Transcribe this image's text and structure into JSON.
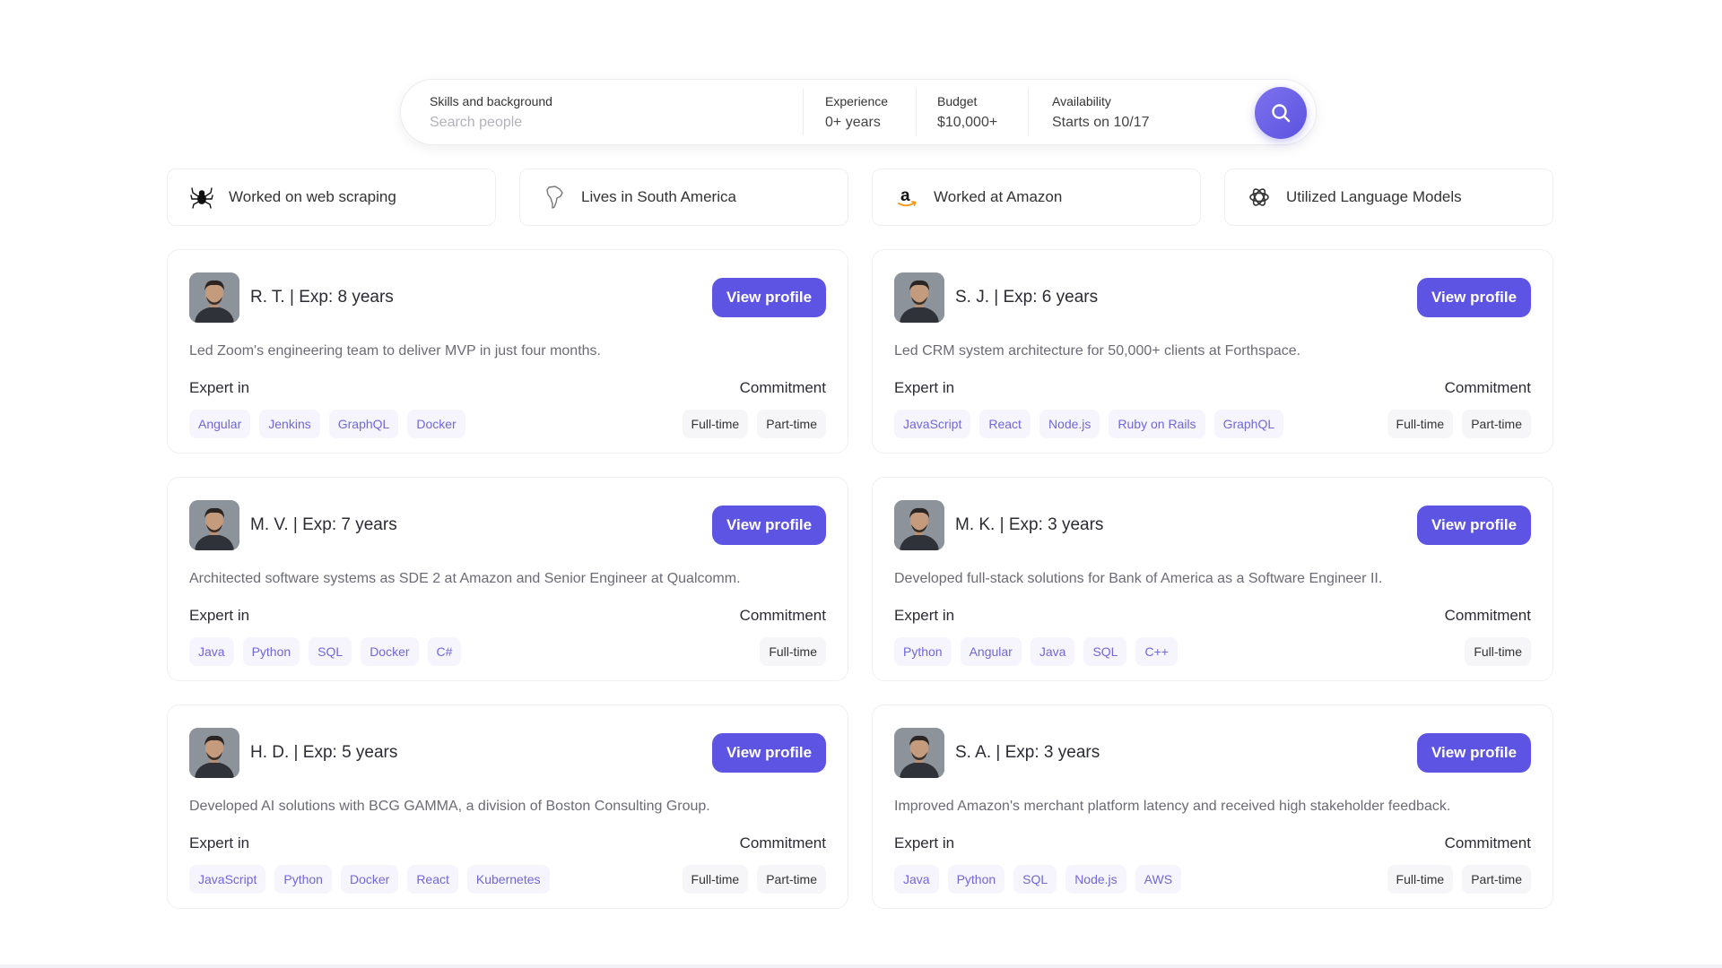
{
  "search": {
    "skills_label": "Skills and background",
    "skills_placeholder": "Search people",
    "experience_label": "Experience",
    "experience_value": "0+ years",
    "budget_label": "Budget",
    "budget_value": "$10,000+",
    "availability_label": "Availability",
    "availability_value": "Starts on 10/17",
    "button_icon": "search-icon"
  },
  "filters": [
    {
      "label": "Worked on web scraping",
      "icon": "spider-icon"
    },
    {
      "label": "Lives in South America",
      "icon": "south-america-icon"
    },
    {
      "label": "Worked at Amazon",
      "icon": "amazon-logo-icon"
    },
    {
      "label": "Utilized Language Models",
      "icon": "openai-logo-icon"
    }
  ],
  "labels": {
    "view_profile": "View profile",
    "expert_in": "Expert in",
    "commitment": "Commitment"
  },
  "colors": {
    "accent": "#5d54e4",
    "skill_tag_text": "#7067d9",
    "skill_tag_bg": "#f6f5fd"
  },
  "candidates": [
    {
      "title": "R. T. | Exp: 8 years",
      "description": "Led Zoom's engineering team to deliver MVP in just four months.",
      "skills": [
        "Angular",
        "Jenkins",
        "GraphQL",
        "Docker"
      ],
      "commitment": [
        "Full-time",
        "Part-time"
      ]
    },
    {
      "title": "S. J. | Exp: 6 years",
      "description": "Led CRM system architecture for 50,000+ clients at Forthspace.",
      "skills": [
        "JavaScript",
        "React",
        "Node.js",
        "Ruby on Rails",
        "GraphQL"
      ],
      "commitment": [
        "Full-time",
        "Part-time"
      ]
    },
    {
      "title": "M. V. | Exp: 7 years",
      "description": "Architected software systems as SDE 2 at Amazon and Senior Engineer at Qualcomm.",
      "skills": [
        "Java",
        "Python",
        "SQL",
        "Docker",
        "C#"
      ],
      "commitment": [
        "Full-time"
      ]
    },
    {
      "title": "M. K. | Exp: 3 years",
      "description": "Developed full-stack solutions for Bank of America as a Software Engineer II.",
      "skills": [
        "Python",
        "Angular",
        "Java",
        "SQL",
        "C++"
      ],
      "commitment": [
        "Full-time"
      ]
    },
    {
      "title": "H. D. | Exp: 5 years",
      "description": "Developed AI solutions with BCG GAMMA, a division of Boston Consulting Group.",
      "skills": [
        "JavaScript",
        "Python",
        "Docker",
        "React",
        "Kubernetes"
      ],
      "commitment": [
        "Full-time",
        "Part-time"
      ]
    },
    {
      "title": "S. A. | Exp: 3 years",
      "description": "Improved Amazon's merchant platform latency and received high stakeholder feedback.",
      "skills": [
        "Java",
        "Python",
        "SQL",
        "Node.js",
        "AWS"
      ],
      "commitment": [
        "Full-time",
        "Part-time"
      ]
    }
  ]
}
